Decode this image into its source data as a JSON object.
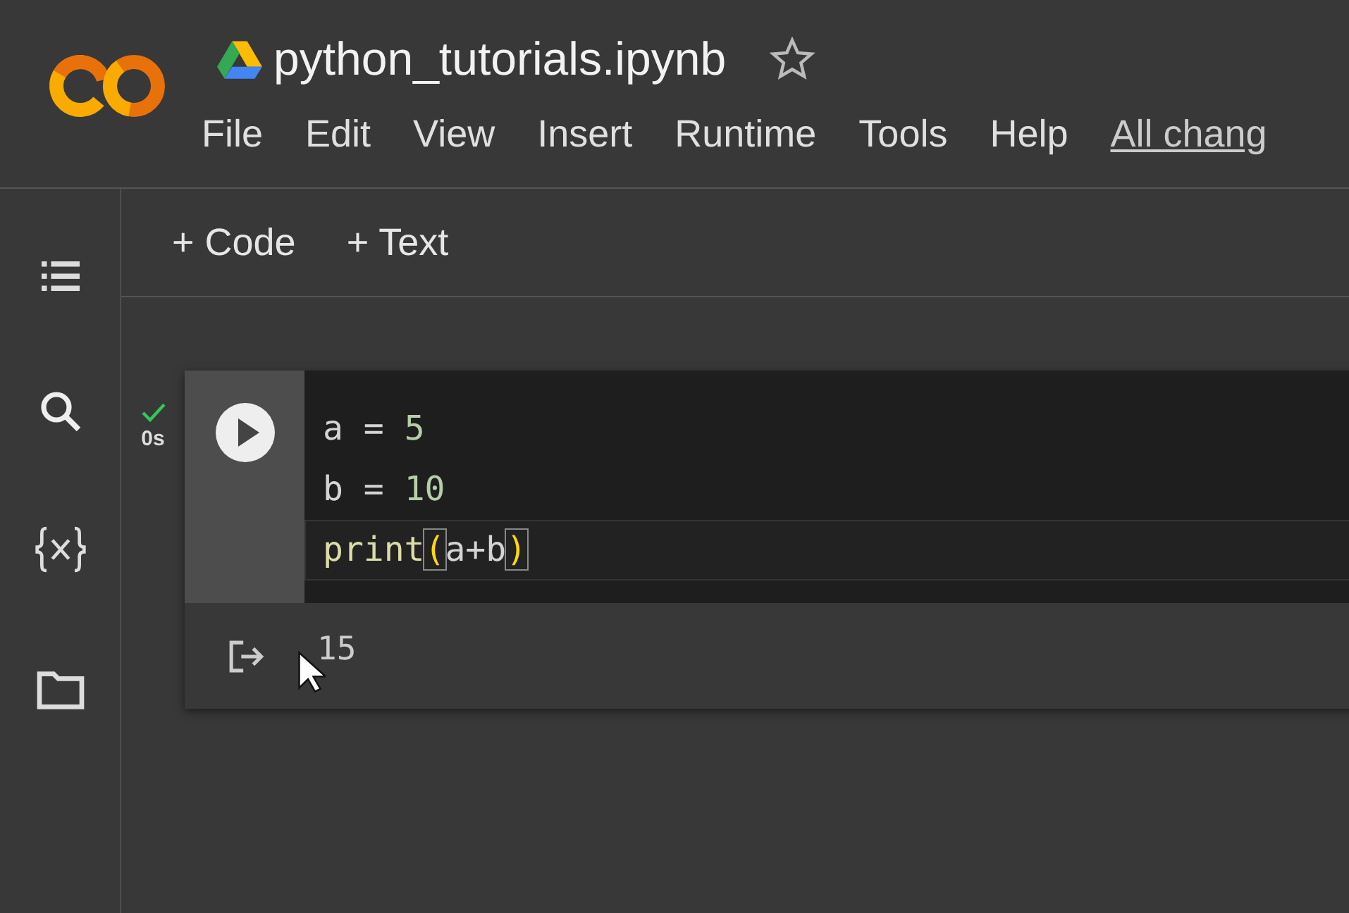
{
  "header": {
    "title": "python_tutorials.ipynb",
    "starred": false,
    "menu": [
      {
        "label": "File",
        "kind": "menu"
      },
      {
        "label": "Edit",
        "kind": "menu"
      },
      {
        "label": "View",
        "kind": "menu"
      },
      {
        "label": "Insert",
        "kind": "menu"
      },
      {
        "label": "Runtime",
        "kind": "menu"
      },
      {
        "label": "Tools",
        "kind": "menu"
      },
      {
        "label": "Help",
        "kind": "menu"
      },
      {
        "label": "All chang",
        "kind": "link"
      }
    ]
  },
  "toolbar": [
    "+ Code",
    "+ Text"
  ],
  "sidebar": {
    "items": [
      {
        "kind": "toc"
      },
      {
        "kind": "search"
      },
      {
        "kind": "variables"
      },
      {
        "kind": "files"
      }
    ]
  },
  "cell": {
    "status": "0s",
    "succeeded": true,
    "lines": [
      {
        "current": false,
        "tokens": [
          {
            "text": "a",
            "kind": "name"
          },
          {
            "text": " = ",
            "kind": "op"
          },
          {
            "text": "5",
            "kind": "number"
          }
        ]
      },
      {
        "current": false,
        "tokens": [
          {
            "text": "b",
            "kind": "name"
          },
          {
            "text": " = ",
            "kind": "op"
          },
          {
            "text": "10",
            "kind": "number"
          }
        ]
      },
      {
        "current": true,
        "tokens": [
          {
            "text": "print",
            "kind": "builtin"
          },
          {
            "text": "(",
            "kind": "bracket-match"
          },
          {
            "text": "a+b",
            "kind": "name"
          },
          {
            "text": ")",
            "kind": "bracket-match"
          }
        ]
      }
    ],
    "output": "15"
  }
}
